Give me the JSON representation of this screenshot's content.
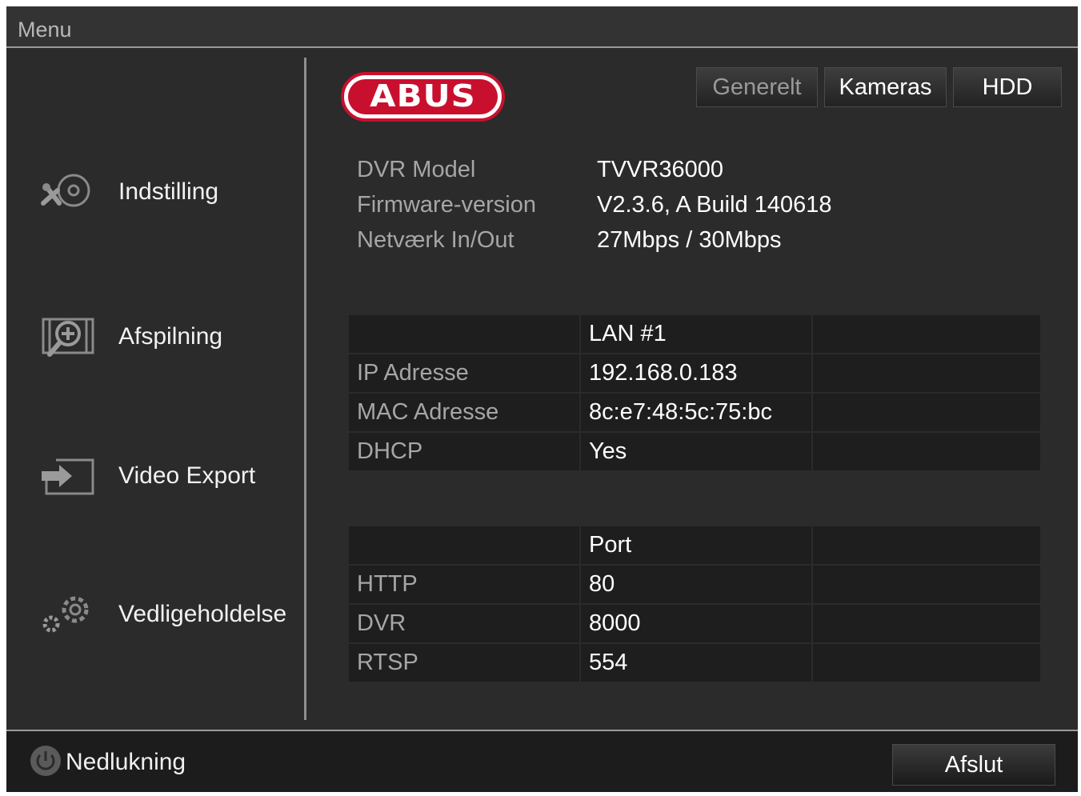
{
  "window": {
    "title": "Menu"
  },
  "sidebar": {
    "items": [
      {
        "label": "Indstilling",
        "icon": "settings-tools-icon"
      },
      {
        "label": "Afspilning",
        "icon": "playback-icon"
      },
      {
        "label": "Video Export",
        "icon": "export-icon"
      },
      {
        "label": "Vedligeholdelse",
        "icon": "maintenance-gears-icon"
      }
    ]
  },
  "logo": {
    "text": "ABUS",
    "color": "#c8102e"
  },
  "tabs": [
    {
      "label": "Generelt",
      "active": true
    },
    {
      "label": "Kameras",
      "active": false
    },
    {
      "label": "HDD",
      "active": false
    }
  ],
  "system_info": [
    {
      "key": "DVR Model",
      "value": "TVVR36000"
    },
    {
      "key": "Firmware-version",
      "value": "V2.3.6, A Build 140618"
    },
    {
      "key": "Netværk In/Out",
      "value": "27Mbps / 30Mbps"
    }
  ],
  "network_table": {
    "header": [
      "",
      "LAN #1",
      ""
    ],
    "rows": [
      [
        "IP Adresse",
        "192.168.0.183",
        ""
      ],
      [
        "MAC Adresse",
        "8c:e7:48:5c:75:bc",
        ""
      ],
      [
        "DHCP",
        "Yes",
        ""
      ]
    ]
  },
  "port_table": {
    "header": [
      "",
      "Port",
      ""
    ],
    "rows": [
      [
        "HTTP",
        "80",
        ""
      ],
      [
        "DVR",
        "8000",
        ""
      ],
      [
        "RTSP",
        "554",
        ""
      ]
    ]
  },
  "footer": {
    "shutdown_label": "Nedlukning",
    "exit_label": "Afslut"
  }
}
